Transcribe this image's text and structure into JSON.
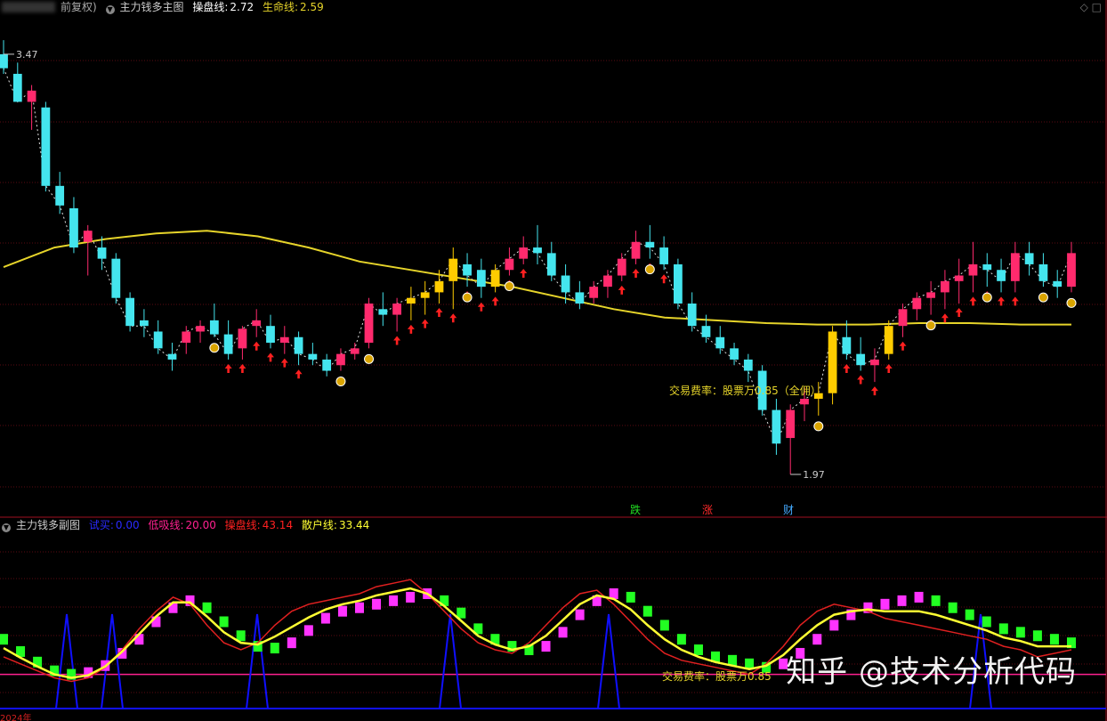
{
  "main_header": {
    "stock_prefix": "前复权)",
    "indicator_name": "主力钱多主图",
    "line1_label": "操盘线:",
    "line1_value": "2.72",
    "line2_label": "生命线:",
    "line2_value": "2.59"
  },
  "sub_header": {
    "indicator_name": "主力钱多副图",
    "buy_label": "试买:",
    "buy_value": "0.00",
    "low_label": "低吸线:",
    "low_value": "20.00",
    "op_label": "操盘线:",
    "op_value": "43.14",
    "retail_label": "散户线:",
    "retail_value": "33.44"
  },
  "colors": {
    "up_body": "#ff2a6d",
    "down_body": "#44e5ee",
    "yellow_body": "#ffcc00",
    "lifeline": "#e6d42a",
    "arrow": "#ff2020",
    "sub_yellow": "#ffff33",
    "sub_red": "#e02020",
    "sub_blue": "#1010ff",
    "sub_magenta": "#ff33ff",
    "sub_green": "#22ff22",
    "low_line": "#ff2090"
  },
  "annotations": {
    "high_label": "3.47",
    "low_label": "1.97",
    "mid_text": "交易费率：股票万0.85（全佣）",
    "sub_text": "交易费率：股票万0.85",
    "sig_fall": "跌",
    "sig_rise": "涨",
    "sig_wealth": "财",
    "x_year": "2024年"
  },
  "watermark": "知乎 @技术分析代码",
  "chart_data": [
    {
      "type": "candlestick",
      "title": "主力钱多主图",
      "ylim": [
        1.9,
        3.6
      ],
      "grid": true,
      "series": [
        {
          "name": "操盘线",
          "last_value": 2.72
        },
        {
          "name": "生命线",
          "last_value": 2.59
        }
      ],
      "annotated_high": 3.47,
      "annotated_low": 1.97,
      "lifeline": [
        2.71,
        2.78,
        2.81,
        2.83,
        2.84,
        2.82,
        2.78,
        2.73,
        2.7,
        2.67,
        2.64,
        2.6,
        2.56,
        2.53,
        2.52,
        2.51,
        2.505,
        2.505,
        2.51,
        2.51,
        2.505,
        2.505
      ],
      "candles": [
        [
          3.47,
          3.52,
          3.4,
          3.42
        ],
        [
          3.4,
          3.44,
          3.3,
          3.3
        ],
        [
          3.3,
          3.36,
          3.2,
          3.34
        ],
        [
          3.28,
          3.3,
          2.98,
          3.0
        ],
        [
          3.0,
          3.05,
          2.9,
          2.93
        ],
        [
          2.92,
          2.96,
          2.76,
          2.78
        ],
        [
          2.8,
          2.86,
          2.68,
          2.84
        ],
        [
          2.78,
          2.82,
          2.7,
          2.74
        ],
        [
          2.74,
          2.76,
          2.58,
          2.6
        ],
        [
          2.6,
          2.62,
          2.48,
          2.5
        ],
        [
          2.52,
          2.56,
          2.46,
          2.5
        ],
        [
          2.48,
          2.52,
          2.4,
          2.42
        ],
        [
          2.4,
          2.44,
          2.34,
          2.38
        ],
        [
          2.44,
          2.5,
          2.4,
          2.48
        ],
        [
          2.48,
          2.52,
          2.44,
          2.5
        ],
        [
          2.52,
          2.58,
          2.46,
          2.47
        ],
        [
          2.47,
          2.52,
          2.38,
          2.4
        ],
        [
          2.42,
          2.5,
          2.38,
          2.49
        ],
        [
          2.5,
          2.56,
          2.46,
          2.52
        ],
        [
          2.5,
          2.54,
          2.42,
          2.44
        ],
        [
          2.44,
          2.5,
          2.4,
          2.46
        ],
        [
          2.46,
          2.48,
          2.36,
          2.4
        ],
        [
          2.4,
          2.44,
          2.36,
          2.38
        ],
        [
          2.38,
          2.4,
          2.32,
          2.34
        ],
        [
          2.36,
          2.42,
          2.34,
          2.4
        ],
        [
          2.4,
          2.44,
          2.38,
          2.42
        ],
        [
          2.44,
          2.6,
          2.42,
          2.58
        ],
        [
          2.56,
          2.62,
          2.5,
          2.54
        ],
        [
          2.54,
          2.6,
          2.48,
          2.58
        ],
        [
          2.58,
          2.64,
          2.52,
          2.6
        ],
        [
          2.6,
          2.66,
          2.54,
          2.62
        ],
        [
          2.62,
          2.7,
          2.58,
          2.66
        ],
        [
          2.66,
          2.78,
          2.56,
          2.74
        ],
        [
          2.72,
          2.76,
          2.64,
          2.68
        ],
        [
          2.7,
          2.74,
          2.6,
          2.64
        ],
        [
          2.64,
          2.72,
          2.62,
          2.7
        ],
        [
          2.7,
          2.78,
          2.68,
          2.74
        ],
        [
          2.74,
          2.82,
          2.72,
          2.78
        ],
        [
          2.78,
          2.86,
          2.72,
          2.76
        ],
        [
          2.76,
          2.8,
          2.66,
          2.68
        ],
        [
          2.68,
          2.72,
          2.58,
          2.62
        ],
        [
          2.62,
          2.66,
          2.56,
          2.58
        ],
        [
          2.6,
          2.66,
          2.58,
          2.64
        ],
        [
          2.64,
          2.7,
          2.6,
          2.68
        ],
        [
          2.68,
          2.76,
          2.66,
          2.74
        ],
        [
          2.74,
          2.84,
          2.72,
          2.8
        ],
        [
          2.8,
          2.86,
          2.74,
          2.78
        ],
        [
          2.78,
          2.82,
          2.7,
          2.72
        ],
        [
          2.72,
          2.74,
          2.56,
          2.58
        ],
        [
          2.58,
          2.62,
          2.48,
          2.5
        ],
        [
          2.5,
          2.54,
          2.44,
          2.46
        ],
        [
          2.46,
          2.5,
          2.4,
          2.42
        ],
        [
          2.42,
          2.44,
          2.36,
          2.38
        ],
        [
          2.38,
          2.4,
          2.3,
          2.34
        ],
        [
          2.34,
          2.36,
          2.18,
          2.2
        ],
        [
          2.2,
          2.24,
          2.04,
          2.08
        ],
        [
          2.1,
          2.22,
          1.97,
          2.2
        ],
        [
          2.22,
          2.28,
          2.16,
          2.24
        ],
        [
          2.24,
          2.3,
          2.18,
          2.26
        ],
        [
          2.26,
          2.5,
          2.22,
          2.48
        ],
        [
          2.46,
          2.52,
          2.38,
          2.4
        ],
        [
          2.4,
          2.46,
          2.34,
          2.36
        ],
        [
          2.36,
          2.42,
          2.3,
          2.38
        ],
        [
          2.4,
          2.52,
          2.38,
          2.5
        ],
        [
          2.5,
          2.58,
          2.46,
          2.56
        ],
        [
          2.56,
          2.62,
          2.52,
          2.6
        ],
        [
          2.6,
          2.66,
          2.54,
          2.62
        ],
        [
          2.62,
          2.7,
          2.56,
          2.66
        ],
        [
          2.66,
          2.74,
          2.58,
          2.68
        ],
        [
          2.68,
          2.8,
          2.62,
          2.72
        ],
        [
          2.72,
          2.76,
          2.64,
          2.7
        ],
        [
          2.7,
          2.74,
          2.62,
          2.66
        ],
        [
          2.66,
          2.8,
          2.62,
          2.76
        ],
        [
          2.76,
          2.8,
          2.68,
          2.72
        ],
        [
          2.72,
          2.76,
          2.64,
          2.66
        ],
        [
          2.66,
          2.7,
          2.6,
          2.64
        ],
        [
          2.64,
          2.8,
          2.62,
          2.76
        ]
      ]
    },
    {
      "type": "line",
      "title": "主力钱多副图",
      "ylim": [
        0,
        100
      ],
      "series": [
        {
          "name": "试买",
          "last_value": 0.0
        },
        {
          "name": "低吸线",
          "last_value": 20.0
        },
        {
          "name": "操盘线",
          "last_value": 43.14
        },
        {
          "name": "散户线",
          "last_value": 33.44
        }
      ],
      "op_line": [
        40,
        33,
        27,
        22,
        20,
        21,
        25,
        32,
        40,
        50,
        58,
        62,
        58,
        50,
        42,
        36,
        35,
        38,
        45,
        52,
        56,
        58,
        60,
        62,
        64,
        66,
        62,
        55,
        46,
        40,
        36,
        34,
        36,
        44,
        54,
        62,
        66,
        64,
        56,
        48,
        40,
        34,
        30,
        28,
        26,
        24,
        26,
        32,
        40,
        48,
        54,
        58,
        60,
        62,
        64,
        62,
        58,
        54,
        50,
        46,
        44,
        42,
        40,
        38
      ],
      "retail_line": [
        30,
        26,
        22,
        18,
        16,
        18,
        24,
        34,
        46,
        56,
        64,
        60,
        48,
        38,
        34,
        38,
        48,
        56,
        60,
        62,
        64,
        66,
        70,
        72,
        74,
        66,
        56,
        46,
        38,
        34,
        32,
        38,
        48,
        58,
        66,
        68,
        60,
        50,
        40,
        32,
        28,
        26,
        24,
        22,
        20,
        26,
        36,
        48,
        56,
        60,
        58,
        56,
        52,
        50,
        48,
        46,
        44,
        42,
        40,
        36,
        34,
        30,
        32,
        34
      ]
    }
  ]
}
